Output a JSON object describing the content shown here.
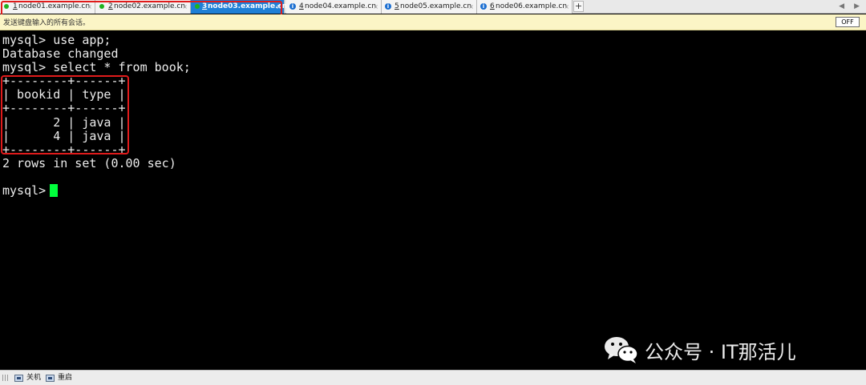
{
  "tabs": [
    {
      "number": "1",
      "label": "node01.example.cn",
      "status": "connected",
      "active": false
    },
    {
      "number": "2",
      "label": "node02.example.cn",
      "status": "connected",
      "active": false
    },
    {
      "number": "3",
      "label": "node03.example.cn",
      "status": "connected",
      "active": true
    },
    {
      "number": "4",
      "label": "node04.example.cn",
      "status": "info",
      "active": false
    },
    {
      "number": "5",
      "label": "node05.example.cn",
      "status": "info",
      "active": false
    },
    {
      "number": "6",
      "label": "node06.example.cn",
      "status": "info",
      "active": false
    }
  ],
  "tab_close_glyph": "×",
  "tab_add_label": "+",
  "notice": {
    "text": "发送键盘输入的所有会话。",
    "off_button": "OFF"
  },
  "terminal": {
    "lines": [
      "mysql> use app;",
      "Database changed",
      "mysql> select * from book;",
      "+--------+------+",
      "| bookid | type |",
      "+--------+------+",
      "|      2 | java |",
      "|      4 | java |",
      "+--------+------+",
      "2 rows in set (0.00 sec)",
      "",
      "mysql> "
    ],
    "query_result": {
      "columns": [
        "bookid",
        "type"
      ],
      "rows": [
        [
          "2",
          "java"
        ],
        [
          "4",
          "java"
        ]
      ]
    }
  },
  "watermark": {
    "text": "公众号 · IT那活儿",
    "icon": "wechat-icon"
  },
  "statusbar": {
    "items": [
      {
        "label": "关机",
        "icon": "shutdown-icon"
      },
      {
        "label": "重启",
        "icon": "restart-icon"
      }
    ]
  },
  "colors": {
    "tab_active": "#1e7fd6",
    "connected_dot": "#1fb21f",
    "info_dot": "#1c6fd1",
    "highlight": "#e01b1b",
    "cursor": "#00ff3c",
    "terminal_bg": "#000000",
    "notice_bg": "#fbf5c6"
  }
}
